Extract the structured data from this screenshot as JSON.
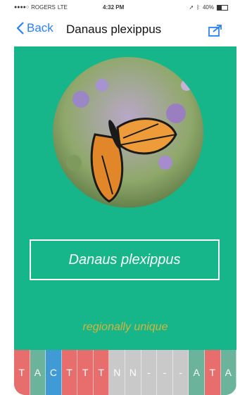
{
  "status_bar": {
    "carrier": "ROGERS",
    "network": "LTE",
    "time": "4:32 PM",
    "battery": "40%",
    "battery_level": 0.4
  },
  "nav": {
    "back_label": "Back",
    "title": "Danaus plexippus",
    "share_icon": "share-icon"
  },
  "species": {
    "name": "Danaus plexippus",
    "tag": "regionally unique"
  },
  "sequence": [
    {
      "base": "T",
      "color": "#e86d6d"
    },
    {
      "base": "A",
      "color": "#6bb39a"
    },
    {
      "base": "C",
      "color": "#3f9ad6"
    },
    {
      "base": "T",
      "color": "#e86d6d"
    },
    {
      "base": "T",
      "color": "#e86d6d"
    },
    {
      "base": "T",
      "color": "#e86d6d"
    },
    {
      "base": "N",
      "color": "#c9c9c9"
    },
    {
      "base": "N",
      "color": "#c9c9c9"
    },
    {
      "base": "-",
      "color": "#c9c9c9"
    },
    {
      "base": "-",
      "color": "#c9c9c9"
    },
    {
      "base": "-",
      "color": "#c9c9c9"
    },
    {
      "base": "A",
      "color": "#6bb39a"
    },
    {
      "base": "T",
      "color": "#e86d6d"
    },
    {
      "base": "A",
      "color": "#6bb39a"
    }
  ],
  "colors": {
    "accent": "#2a7fff",
    "background": "#16b58a",
    "tag": "#d4b43a"
  }
}
